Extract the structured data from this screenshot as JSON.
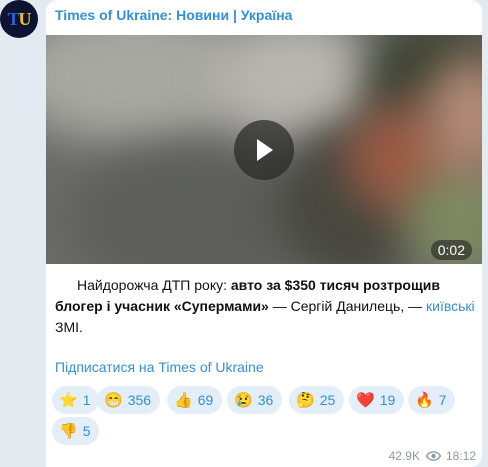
{
  "channel": {
    "avatar_letter_1": "T",
    "avatar_letter_2": "U",
    "title": "Times of Ukraine: Новини | Україна"
  },
  "video": {
    "duration": "0:02",
    "play_icon": "play-icon"
  },
  "caption": {
    "part1": "Найдорожча ДТП року: ",
    "bold1": "авто за $350 тисяч розтрощив блогер і учасник «Супермами»",
    "part2": " — Сергій Данилець, — ",
    "link": "київські",
    "part3": " ЗМІ."
  },
  "subscribe_link": "Підписатися на Times of Ukraine",
  "reactions": [
    {
      "emoji": "⭐",
      "count": "1"
    },
    {
      "emoji": "😁",
      "count": "356"
    },
    {
      "emoji": "👍",
      "count": "69"
    },
    {
      "emoji": "😢",
      "count": "36"
    },
    {
      "emoji": "🤔",
      "count": "25"
    },
    {
      "emoji": "❤️",
      "count": "19"
    },
    {
      "emoji": "🔥",
      "count": "7"
    },
    {
      "emoji": "👎",
      "count": "5"
    }
  ],
  "meta": {
    "views": "42.9K",
    "time": "18:12"
  },
  "colors": {
    "link": "#3390d6",
    "reaction_bg": "#e3eef9"
  }
}
